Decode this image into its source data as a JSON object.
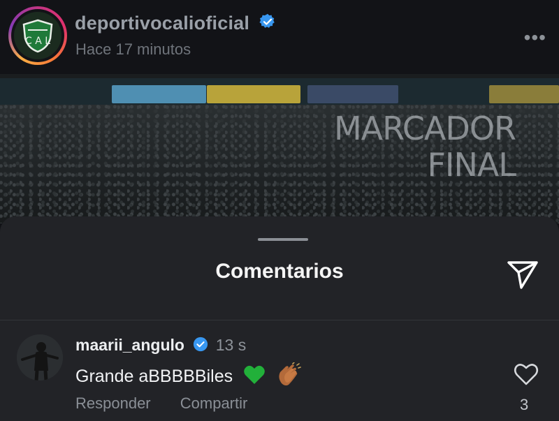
{
  "post": {
    "username": "deportivocalioficial",
    "time_ago": "Hace 17 minutos",
    "more_menu": "•••",
    "image_title_line1": "MARCADOR",
    "image_title_line2": "FINAL"
  },
  "comments_sheet": {
    "title": "Comentarios"
  },
  "comment": {
    "username": "maarii_angulo",
    "time": "13 s",
    "text": "Grande aBBBBBiles",
    "reply_label": "Responder",
    "share_label": "Compartir",
    "like_count": "3"
  },
  "colors": {
    "background": "#111216",
    "sheet": "#222327",
    "verified": "#3897f0",
    "heart_emoji": "#22b03a"
  }
}
